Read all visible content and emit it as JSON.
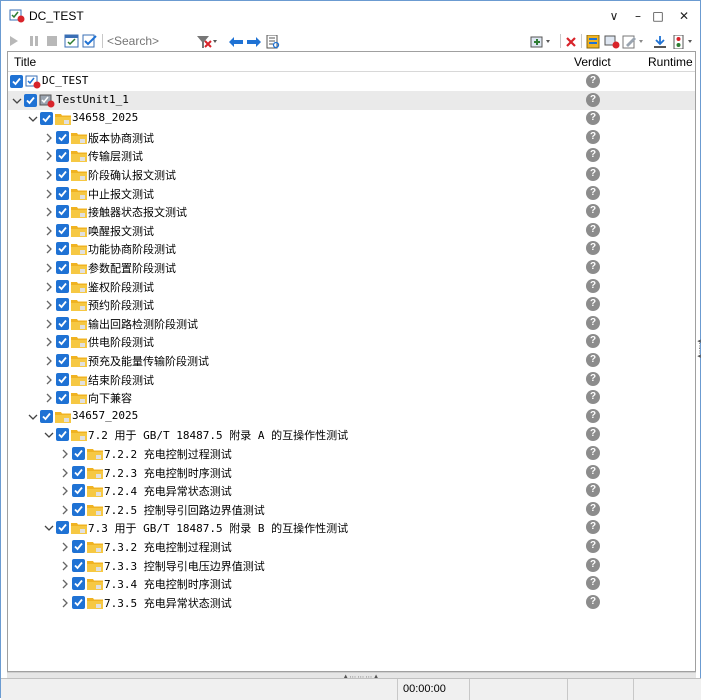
{
  "window": {
    "title": "DC_TEST"
  },
  "window_controls": {
    "dropdown": "∨",
    "minimize": "–",
    "maximize": "□",
    "close": "✕"
  },
  "toolbar": {
    "search_placeholder": "<Search>"
  },
  "columns": {
    "title": "Title",
    "verdict": "Verdict",
    "runtime": "Runtime"
  },
  "tree": [
    {
      "level": 0,
      "label": "DC_TEST",
      "expander": "",
      "icon": "root"
    },
    {
      "level": 0,
      "label": "TestUnit1_1",
      "expander": "down",
      "icon": "unit"
    },
    {
      "level": 1,
      "label": "34658_2025",
      "expander": "down",
      "icon": "folder"
    },
    {
      "level": 2,
      "label": "版本协商测试",
      "expander": "right",
      "icon": "folder"
    },
    {
      "level": 2,
      "label": "传输层测试",
      "expander": "right",
      "icon": "folder"
    },
    {
      "level": 2,
      "label": "阶段确认报文测试",
      "expander": "right",
      "icon": "folder"
    },
    {
      "level": 2,
      "label": "中止报文测试",
      "expander": "right",
      "icon": "folder"
    },
    {
      "level": 2,
      "label": "接触器状态报文测试",
      "expander": "right",
      "icon": "folder"
    },
    {
      "level": 2,
      "label": "唤醒报文测试",
      "expander": "right",
      "icon": "folder"
    },
    {
      "level": 2,
      "label": "功能协商阶段测试",
      "expander": "right",
      "icon": "folder"
    },
    {
      "level": 2,
      "label": "参数配置阶段测试",
      "expander": "right",
      "icon": "folder"
    },
    {
      "level": 2,
      "label": "鉴权阶段测试",
      "expander": "right",
      "icon": "folder"
    },
    {
      "level": 2,
      "label": "预约阶段测试",
      "expander": "right",
      "icon": "folder"
    },
    {
      "level": 2,
      "label": "输出回路检测阶段测试",
      "expander": "right",
      "icon": "folder"
    },
    {
      "level": 2,
      "label": "供电阶段测试",
      "expander": "right",
      "icon": "folder"
    },
    {
      "level": 2,
      "label": "预充及能量传输阶段测试",
      "expander": "right",
      "icon": "folder"
    },
    {
      "level": 2,
      "label": "结束阶段测试",
      "expander": "right",
      "icon": "folder"
    },
    {
      "level": 2,
      "label": "向下兼容",
      "expander": "right",
      "icon": "folder"
    },
    {
      "level": 1,
      "label": "34657_2025",
      "expander": "down",
      "icon": "folder"
    },
    {
      "level": 2,
      "label": "7.2 用于 GB/T 18487.5 附录 A 的互操作性测试",
      "expander": "down",
      "icon": "folder"
    },
    {
      "level": 3,
      "label": "7.2.2 充电控制过程测试",
      "expander": "right",
      "icon": "folder"
    },
    {
      "level": 3,
      "label": "7.2.3 充电控制时序测试",
      "expander": "right",
      "icon": "folder"
    },
    {
      "level": 3,
      "label": "7.2.4 充电异常状态测试",
      "expander": "right",
      "icon": "folder"
    },
    {
      "level": 3,
      "label": "7.2.5 控制导引回路边界值测试",
      "expander": "right",
      "icon": "folder"
    },
    {
      "level": 2,
      "label": "7.3 用于 GB/T 18487.5 附录 B 的互操作性测试",
      "expander": "down",
      "icon": "folder"
    },
    {
      "level": 3,
      "label": "7.3.2 充电控制过程测试",
      "expander": "right",
      "icon": "folder"
    },
    {
      "level": 3,
      "label": "7.3.3 控制导引电压边界值测试",
      "expander": "right",
      "icon": "folder"
    },
    {
      "level": 3,
      "label": "7.3.4 充电控制时序测试",
      "expander": "right",
      "icon": "folder"
    },
    {
      "level": 3,
      "label": "7.3.5 充电异常状态测试",
      "expander": "right",
      "icon": "folder"
    }
  ],
  "verdict_symbol": "?",
  "status": {
    "elapsed": "00:00:00"
  },
  "colors": {
    "checkbox": "#1f72d4",
    "folder": "#f0b322",
    "verdict": "#8c8c8c",
    "accent_red": "#d8232a"
  }
}
